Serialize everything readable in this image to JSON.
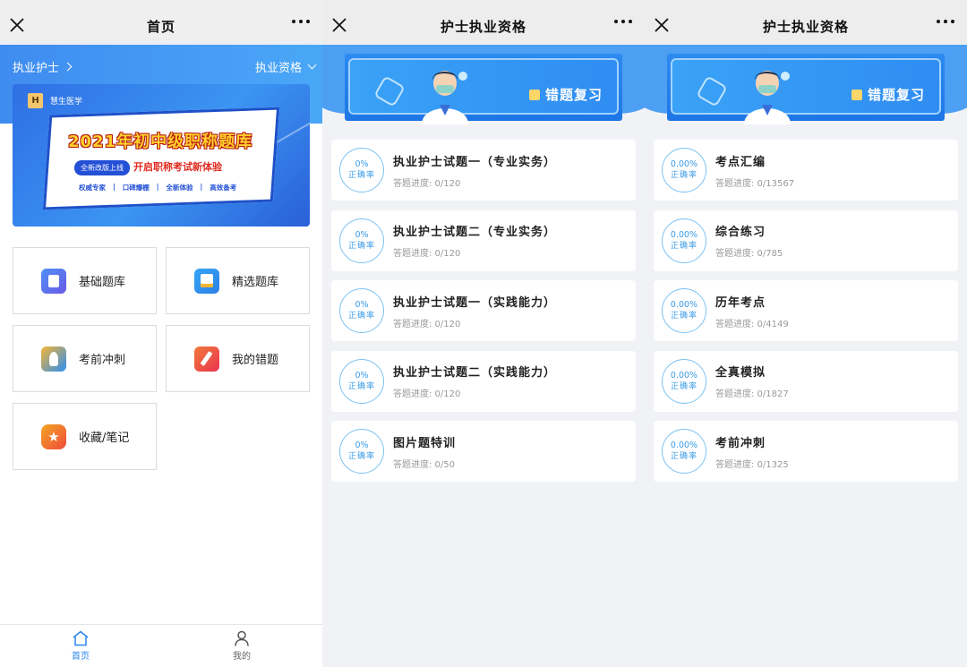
{
  "home": {
    "title": "首页",
    "header_left": "执业护士",
    "header_right": "执业资格",
    "banner": {
      "brand": "慧生医学",
      "headline": "2021年初中级职称题库",
      "pill": "全新改版上线",
      "slogan": "开启职称考试新体验",
      "features": [
        "权威专家",
        "口碑爆棚",
        "全新体验",
        "高效备考"
      ]
    },
    "tiles": [
      {
        "label": "基础题库",
        "icon": "question-bank-icon"
      },
      {
        "label": "精选题库",
        "icon": "selected-bank-icon"
      },
      {
        "label": "考前冲刺",
        "icon": "rocket-icon"
      },
      {
        "label": "我的错题",
        "icon": "pencil-icon"
      },
      {
        "label": "收藏/笔记",
        "icon": "star-icon"
      }
    ],
    "tabbar": [
      {
        "label": "首页",
        "icon": "home-icon",
        "active": true
      },
      {
        "label": "我的",
        "icon": "user-icon",
        "active": false
      }
    ]
  },
  "panel2": {
    "title": "护士执业资格",
    "hero_label": "错题复习",
    "correct_label": "正确率",
    "items": [
      {
        "pct": "0%",
        "name": "执业护士试题一（专业实务）",
        "progress": "答题进度: 0/120"
      },
      {
        "pct": "0%",
        "name": "执业护士试题二（专业实务）",
        "progress": "答题进度: 0/120"
      },
      {
        "pct": "0%",
        "name": "执业护士试题一（实践能力）",
        "progress": "答题进度: 0/120"
      },
      {
        "pct": "0%",
        "name": "执业护士试题二（实践能力）",
        "progress": "答题进度: 0/120"
      },
      {
        "pct": "0%",
        "name": "图片题特训",
        "progress": "答题进度: 0/50"
      }
    ]
  },
  "panel3": {
    "title": "护士执业资格",
    "hero_label": "错题复习",
    "correct_label": "正确率",
    "items": [
      {
        "pct": "0.00%",
        "name": "考点汇编",
        "progress": "答题进度: 0/13567"
      },
      {
        "pct": "0.00%",
        "name": "综合练习",
        "progress": "答题进度: 0/785"
      },
      {
        "pct": "0.00%",
        "name": "历年考点",
        "progress": "答题进度: 0/4149"
      },
      {
        "pct": "0.00%",
        "name": "全真模拟",
        "progress": "答题进度: 0/1827"
      },
      {
        "pct": "0.00%",
        "name": "考前冲刺",
        "progress": "答题进度: 0/1325"
      }
    ]
  },
  "colors": {
    "accent": "#2e86f0",
    "ring": "#7cc2f2",
    "ring_text": "#3b9be6"
  }
}
